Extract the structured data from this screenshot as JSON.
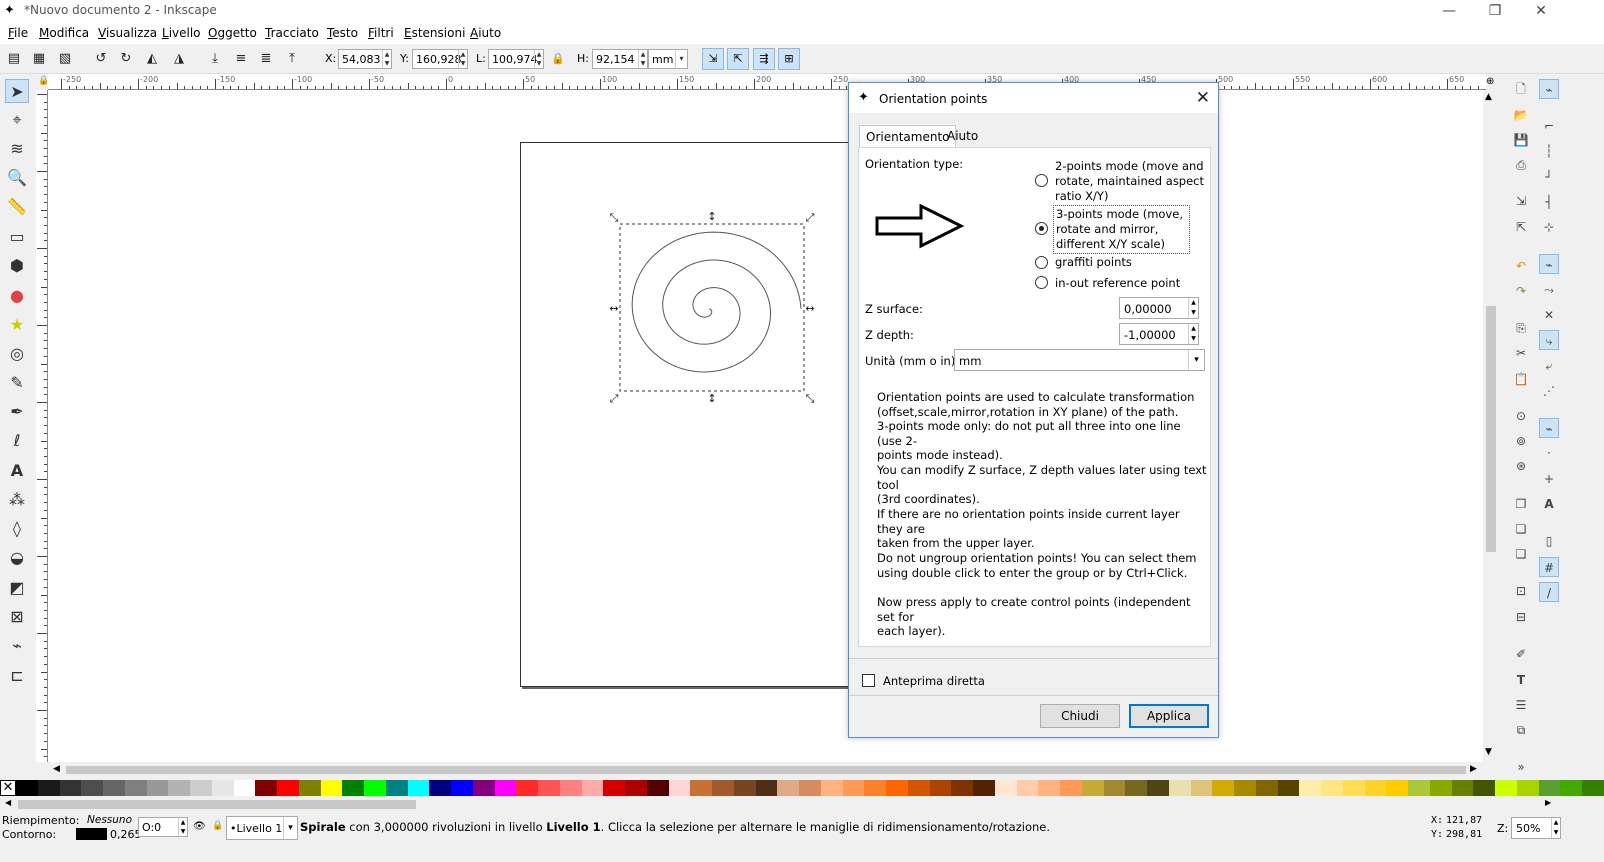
{
  "window": {
    "title": "*Nuovo documento 2 - Inkscape",
    "min_glyph": "—",
    "max_glyph": "❐",
    "close_glyph": "✕"
  },
  "menu": [
    "File",
    "Modifica",
    "Visualizza",
    "Livello",
    "Oggetto",
    "Tracciato",
    "Testo",
    "Filtri",
    "Estensioni",
    "Aiuto"
  ],
  "toolbar": {
    "x_label": "X:",
    "x_value": "54,083",
    "y_label": "Y:",
    "y_value": "160,928",
    "w_label": "L:",
    "w_value": "100,974",
    "h_label": "H:",
    "h_value": "92,154",
    "unit": "mm"
  },
  "ruler_h": [
    "-250",
    "-200",
    "-150",
    "-100",
    "-50",
    "0",
    "50",
    "100",
    "150",
    "200",
    "250",
    "300",
    "350",
    "400",
    "450",
    "500",
    "550",
    "600",
    "650"
  ],
  "dialog": {
    "title": "Orientation points",
    "tabs": [
      "Orientamento",
      "Aiuto"
    ],
    "orientation_type_label": "Orientation type:",
    "modes": [
      {
        "text": "2-points mode\n(move and rotate,\nmaintained aspect ratio X/Y)",
        "checked": false
      },
      {
        "text": "3-points mode\n(move, rotate and mirror,\ndifferent X/Y scale)",
        "checked": true
      },
      {
        "text": "graffiti points",
        "checked": false
      },
      {
        "text": "in-out reference point",
        "checked": false
      }
    ],
    "z_surface_label": "Z surface:",
    "z_surface_value": "0,00000",
    "z_depth_label": "Z depth:",
    "z_depth_value": "-1,00000",
    "units_label": "Unità (mm o in):",
    "units_value": "mm",
    "help": [
      "Orientation points are used to calculate transformation\n(offset,scale,mirror,rotation in XY plane) of the path.\n3-points mode only: do not put all three into one line (use 2-\npoints mode instead).",
      "You can modify Z surface, Z depth values later using text tool\n(3rd coordinates).",
      "If there are no orientation points inside current layer they are\ntaken from the upper layer.",
      "Do not ungroup orientation points! You can select them\nusing double click to enter the group or by Ctrl+Click.",
      "Now press apply to create control points (independent set for\neach layer)."
    ],
    "live_preview_label": "Anteprima diretta",
    "close_button": "Chiudi",
    "apply_button": "Applica"
  },
  "palette": [
    "#000000",
    "#1a1a1a",
    "#333333",
    "#4d4d4d",
    "#666666",
    "#808080",
    "#999999",
    "#b3b3b3",
    "#cccccc",
    "#e6e6e6",
    "#ffffff",
    "#800000",
    "#ff0000",
    "#808000",
    "#ffff00",
    "#008000",
    "#00ff00",
    "#008080",
    "#00ffff",
    "#000080",
    "#0000ff",
    "#800080",
    "#ff00ff",
    "#ff2a2a",
    "#ff5555",
    "#ff8080",
    "#ffaaaa",
    "#d40000",
    "#aa0000",
    "#550000",
    "#ffd5d5",
    "#c87137",
    "#a05a2c",
    "#784421",
    "#502d16",
    "#deaa87",
    "#d38d5f",
    "#ffb380",
    "#ff9955",
    "#ff7f2a",
    "#ff6600",
    "#d45500",
    "#aa4400",
    "#803300",
    "#552200",
    "#ffe6d5",
    "#ffccaa",
    "#ffb380",
    "#ff9955",
    "#c8ab37",
    "#a08932",
    "#786721",
    "#504416",
    "#e9dfaf",
    "#ddc67c",
    "#d4aa00",
    "#aa8800",
    "#806600",
    "#554400",
    "#ffeeaa",
    "#ffe680",
    "#ffdd55",
    "#ffd42a",
    "#ffcc00",
    "#abc837",
    "#88aa00",
    "#668000",
    "#445500",
    "#ccff00",
    "#aad400",
    "#5aa02c",
    "#44aa00",
    "#338000"
  ],
  "status": {
    "fill_label": "Riempimento:",
    "fill_value": "Nessuno",
    "stroke_label": "Contorno:",
    "stroke_width": "0,265",
    "opacity": "0",
    "layer": "•Livello 1",
    "message_bold1": "Spirale",
    "message_mid": " con 3,000000 rivoluzioni in livello ",
    "message_bold2": "Livello 1",
    "message_end": ". Clicca la selezione per alternare le maniglie di ridimensionamento/rotazione.",
    "coord_x_label": "X:",
    "coord_x": "121,87",
    "coord_y_label": "Y:",
    "coord_y": "298,81",
    "zoom_label": "Z:",
    "zoom": "50%"
  },
  "icons": {
    "app": "inkscape-icon",
    "selector": "pointer-icon"
  }
}
